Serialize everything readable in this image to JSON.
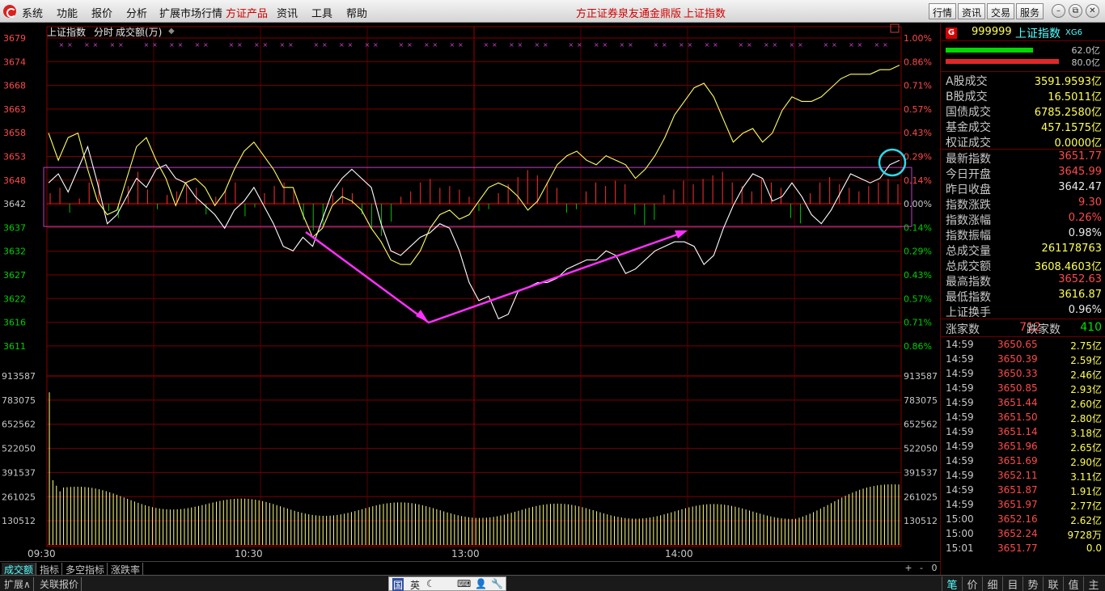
{
  "menubar": {
    "items": [
      "系统",
      "功能",
      "报价",
      "分析",
      "扩展市场行情",
      "方证产品",
      "资讯",
      "工具",
      "帮助"
    ],
    "center_title": "方正证券泉友通金鼎版",
    "center_index": "上证指数",
    "right_buttons": [
      "行情",
      "资讯",
      "交易",
      "服务"
    ],
    "window_buttons": [
      "–",
      "⧉",
      "✕"
    ]
  },
  "chart_header": {
    "name": "上证指数",
    "mode": "分时",
    "indicator": "成交额(万)",
    "toggle": "◆"
  },
  "chart_data": {
    "type": "line",
    "price_axis": {
      "labels": [
        "3679",
        "3674",
        "3668",
        "3663",
        "3658",
        "3653",
        "3648",
        "3642",
        "3637",
        "3632",
        "3627",
        "3622",
        "3616",
        "3611"
      ],
      "pct_labels": [
        "1.00%",
        "0.86%",
        "0.71%",
        "0.57%",
        "0.43%",
        "0.29%",
        "0.14%",
        "0.00%",
        "0.14%",
        "0.29%",
        "0.43%",
        "0.57%",
        "0.71%",
        "0.86%"
      ],
      "ylim": [
        3611,
        3679
      ],
      "prev_close": 3642.47
    },
    "volume_axis": {
      "labels": [
        "913587",
        "783075",
        "652562",
        "522050",
        "391537",
        "261025",
        "130512"
      ],
      "ylim": [
        0,
        913587
      ]
    },
    "x_labels": [
      "09:30",
      "10:30",
      "13:00",
      "14:00"
    ],
    "series": [
      {
        "name": "white",
        "values": [
          3647,
          3649,
          3645,
          3650,
          3655,
          3647,
          3638,
          3640,
          3644,
          3648,
          3646,
          3650,
          3651,
          3648,
          3647,
          3644,
          3642,
          3640,
          3637,
          3641,
          3643,
          3646,
          3642,
          3638,
          3633,
          3632,
          3635,
          3633,
          3639,
          3645,
          3648,
          3650,
          3648,
          3646,
          3638,
          3632,
          3631,
          3633,
          3635,
          3636,
          3638,
          3637,
          3632,
          3625,
          3621,
          3622,
          3617,
          3618,
          3623,
          3624,
          3625,
          3625,
          3626,
          3628,
          3629,
          3630,
          3630,
          3632,
          3631,
          3627,
          3628,
          3630,
          3632,
          3633,
          3634,
          3634,
          3633,
          3629,
          3631,
          3637,
          3642,
          3646,
          3649,
          3648,
          3643,
          3644,
          3647,
          3644,
          3640,
          3638,
          3641,
          3645,
          3649,
          3648,
          3647,
          3648,
          3651,
          3652
        ]
      },
      {
        "name": "yellow",
        "values": [
          3658,
          3652,
          3657,
          3658,
          3650,
          3643,
          3640,
          3641,
          3648,
          3655,
          3657,
          3652,
          3648,
          3642,
          3647,
          3648,
          3646,
          3642,
          3645,
          3650,
          3654,
          3656,
          3653,
          3650,
          3646,
          3646,
          3640,
          3635,
          3637,
          3642,
          3644,
          3643,
          3641,
          3637,
          3634,
          3630,
          3629,
          3629,
          3632,
          3637,
          3640,
          3641,
          3639,
          3640,
          3643,
          3646,
          3647,
          3646,
          3644,
          3641,
          3643,
          3647,
          3651,
          3653,
          3654,
          3652,
          3651,
          3653,
          3652,
          3651,
          3648,
          3650,
          3653,
          3657,
          3662,
          3665,
          3668,
          3669,
          3666,
          3661,
          3656,
          3658,
          3659,
          3656,
          3658,
          3663,
          3666,
          3665,
          3665,
          3666,
          3668,
          3670,
          3671,
          3671,
          3671,
          3672,
          3672,
          3673
        ]
      }
    ],
    "bias_bars": [
      6,
      9,
      -5,
      3,
      12,
      14,
      -4,
      -8,
      10,
      18,
      8,
      -3,
      5,
      7,
      11,
      9,
      -6,
      4,
      8,
      12,
      -7,
      -2,
      6,
      10,
      12,
      8,
      -9,
      -15,
      -12,
      5,
      9,
      6,
      -6,
      -14,
      -18,
      -10,
      4,
      7,
      12,
      14,
      9,
      10,
      8,
      4,
      -4,
      -3,
      6,
      11,
      15,
      19,
      16,
      12,
      9,
      -5,
      -3,
      7,
      12,
      10,
      13,
      11,
      -6,
      -12,
      -9,
      5,
      8,
      13,
      11,
      14,
      16,
      18,
      12,
      10,
      7,
      14,
      12,
      9,
      -8,
      -11,
      6,
      12,
      15,
      11,
      9,
      7,
      10,
      12,
      14,
      11
    ]
  },
  "right_panel": {
    "code": "999999",
    "name": "上证指数",
    "tag": "XG6",
    "bar_green_label": "62.0亿",
    "bar_red_label": "80.0亿",
    "bar_green_value": 62.0,
    "bar_red_value": 80.0,
    "turnover": [
      {
        "k": "A股成交",
        "v": "3591.9593亿"
      },
      {
        "k": "B股成交",
        "v": "16.5011亿"
      },
      {
        "k": "国债成交",
        "v": "6785.2580亿"
      },
      {
        "k": "基金成交",
        "v": "457.1575亿"
      },
      {
        "k": "权证成交",
        "v": "0.0000亿"
      }
    ],
    "index_stats": [
      {
        "k": "最新指数",
        "v": "3651.77",
        "c": "red"
      },
      {
        "k": "今日开盘",
        "v": "3645.99",
        "c": "red"
      },
      {
        "k": "昨日收盘",
        "v": "3642.47",
        "c": "white"
      },
      {
        "k": "指数涨跌",
        "v": "9.30",
        "c": "red"
      },
      {
        "k": "指数涨幅",
        "v": "0.26%",
        "c": "red"
      },
      {
        "k": "指数振幅",
        "v": "0.98%",
        "c": "white"
      },
      {
        "k": "总成交量",
        "v": "261178763",
        "c": "yellow"
      },
      {
        "k": "总成交额",
        "v": "3608.4603亿",
        "c": "yellow"
      },
      {
        "k": "最高指数",
        "v": "3652.63",
        "c": "red"
      },
      {
        "k": "最低指数",
        "v": "3616.87",
        "c": "yellow"
      },
      {
        "k": "上证换手",
        "v": "0.96%",
        "c": "white"
      }
    ],
    "up_label": "涨家数",
    "up_count": "712",
    "down_label": "跌家数",
    "down_count": "410",
    "ticks": [
      {
        "t": "14:59",
        "p": "3650.65",
        "a": "2.75亿"
      },
      {
        "t": "14:59",
        "p": "3650.39",
        "a": "2.59亿"
      },
      {
        "t": "14:59",
        "p": "3650.33",
        "a": "2.46亿"
      },
      {
        "t": "14:59",
        "p": "3650.85",
        "a": "2.93亿"
      },
      {
        "t": "14:59",
        "p": "3651.44",
        "a": "2.60亿"
      },
      {
        "t": "14:59",
        "p": "3651.50",
        "a": "2.80亿"
      },
      {
        "t": "14:59",
        "p": "3651.14",
        "a": "3.18亿"
      },
      {
        "t": "14:59",
        "p": "3651.96",
        "a": "2.65亿"
      },
      {
        "t": "14:59",
        "p": "3651.69",
        "a": "2.90亿"
      },
      {
        "t": "14:59",
        "p": "3652.11",
        "a": "3.11亿"
      },
      {
        "t": "14:59",
        "p": "3651.87",
        "a": "1.91亿"
      },
      {
        "t": "14:59",
        "p": "3651.97",
        "a": "2.77亿"
      },
      {
        "t": "15:00",
        "p": "3652.16",
        "a": "2.62亿"
      },
      {
        "t": "15:00",
        "p": "3652.24",
        "a": "9728万"
      },
      {
        "t": "15:01",
        "p": "3651.77",
        "a": "0.0"
      }
    ]
  },
  "bottom_tabs": [
    "成交额",
    "指标",
    "多空指标",
    "涨跌率"
  ],
  "bottom_small": [
    "+",
    "-",
    "0"
  ],
  "status_tabs": [
    "扩展∧",
    "关联报价"
  ],
  "ime": [
    "国",
    "英",
    "☾",
    "⌨",
    "👤",
    "🔧"
  ],
  "right_tabs": [
    "笔",
    "价",
    "细",
    "目",
    "势",
    "联",
    "值",
    "主"
  ]
}
